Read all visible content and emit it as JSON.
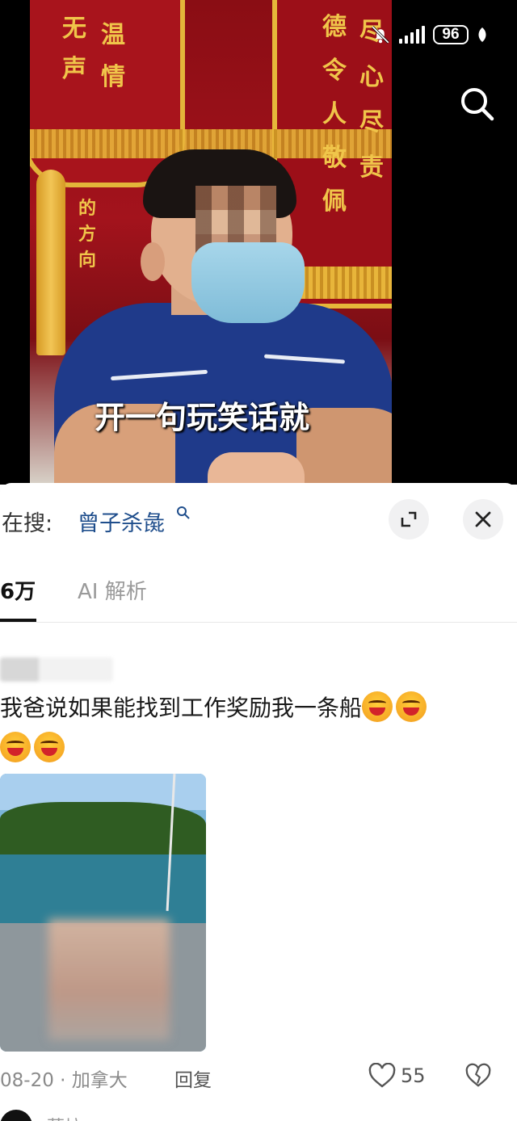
{
  "status_bar": {
    "battery": "96",
    "icons": [
      "bell-off-icon",
      "signal-icon",
      "battery-icon",
      "leaf-icon"
    ]
  },
  "video": {
    "subtitle": "开一句玩笑话就",
    "banner_text_left": [
      "无",
      "声",
      "温",
      "情",
      "的",
      "方",
      "向"
    ],
    "banner_text_right": [
      "德",
      "令",
      "人",
      "敬",
      "佩",
      "尽",
      "心",
      "尽",
      "责"
    ]
  },
  "search": {
    "prefix": "在搜:",
    "query": "曾子杀彘",
    "expand_icon": "expand-icon",
    "close_icon": "close-icon"
  },
  "tabs": {
    "comments": "6万",
    "ai": "AI 解析"
  },
  "comment": {
    "text": "我爸说如果能找到工作奖励我一条船",
    "date": "08-20 · 加拿大",
    "reply": "回复",
    "likes": "55"
  },
  "next_comment": {
    "name": "蔡垃"
  },
  "colors": {
    "query": "#1f4e8c",
    "banner_red": "#a3131c",
    "banner_gold": "#e6b73a"
  }
}
